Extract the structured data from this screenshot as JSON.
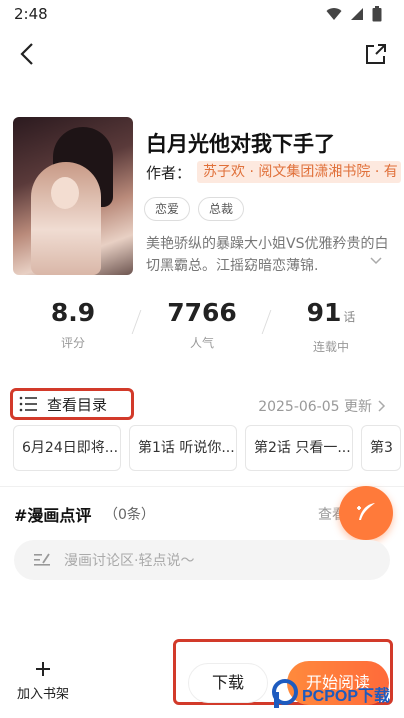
{
  "status_bar": {
    "time": "2:48"
  },
  "book": {
    "title": "白月光他对我下手了",
    "author_label": "作者：",
    "author_value": "苏子欢 · 阅文集团潇湘书院 · 有",
    "tags": [
      "恋爱",
      "总裁"
    ],
    "description": "美艳骄纵的暴躁大小姐VS优雅矜贵的白切黑霸总。江摇窈暗恋薄锦."
  },
  "stats": [
    {
      "value": "8.9",
      "unit": "",
      "label": "评分"
    },
    {
      "value": "7766",
      "unit": "",
      "label": "人气"
    },
    {
      "value": "91",
      "unit": "话",
      "label": "连载中"
    }
  ],
  "catalog": {
    "label": "查看目录",
    "update_text": "2025-06-05 更新"
  },
  "chapters": [
    "6月24日即将...",
    "第1话 听说你...",
    "第2话 只看一...",
    "第3"
  ],
  "review": {
    "title": "#漫画点评",
    "count": "（0条）",
    "view_label": "查看",
    "placeholder": "漫画讨论区·轻点说～"
  },
  "bottom": {
    "shelf_label": "加入书架",
    "download_label": "下载",
    "read_label": "开始阅读"
  },
  "watermark": {
    "text": "PCPOP下载"
  },
  "colors": {
    "accent": "#ff7a3a",
    "highlight_frame": "#d23a2a",
    "author_chip_bg": "#fde9df"
  }
}
